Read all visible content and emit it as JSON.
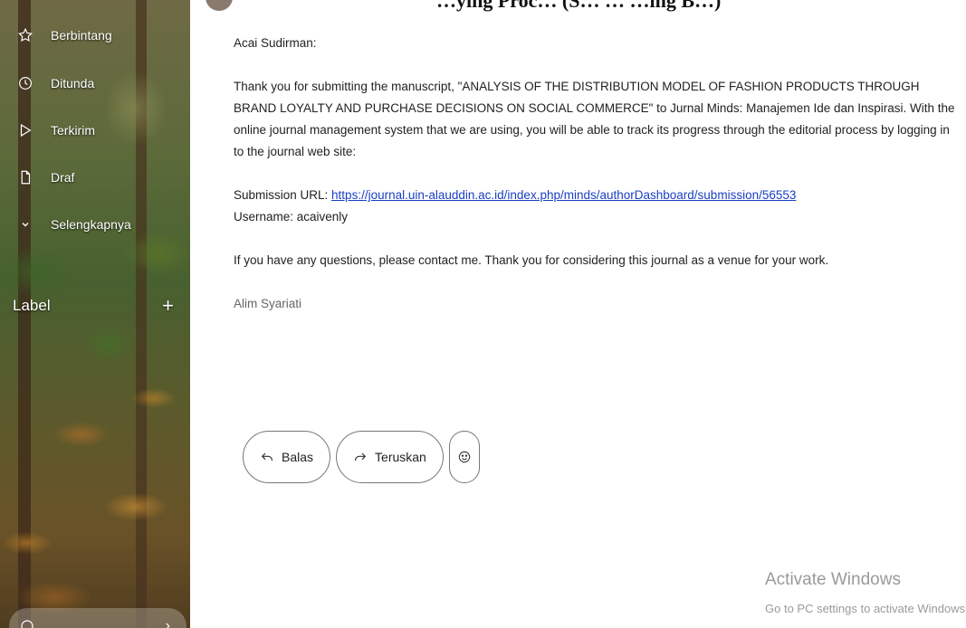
{
  "sidebar": {
    "items": [
      {
        "label": "Berbintang",
        "icon": "star-icon"
      },
      {
        "label": "Ditunda",
        "icon": "clock-icon"
      },
      {
        "label": "Terkirim",
        "icon": "send-icon"
      },
      {
        "label": "Draf",
        "icon": "draft-file-icon"
      },
      {
        "label": "Selengkapnya",
        "icon": "chevron-down-icon"
      }
    ],
    "label_section": {
      "title": "Label",
      "add_symbol": "+"
    }
  },
  "email": {
    "top_fragment": "…ying Proc… (S… … …ing B…)",
    "greeting": "Acai Sudirman:",
    "body": "Thank you for submitting the manuscript, \"ANALYSIS OF THE DISTRIBUTION MODEL OF FASHION PRODUCTS THROUGH BRAND LOYALTY AND PURCHASE DECISIONS ON SOCIAL COMMERCE\" to Jurnal Minds: Manajemen Ide dan Inspirasi. With the online journal management system that we are using, you will be able to track its progress through the editorial process by logging in to the journal web site:",
    "submission_label": "Submission URL: ",
    "submission_url": "https://journal.uin-alauddin.ac.id/index.php/minds/authorDashboard/submission/56553",
    "username_line": "Username: acaivenly",
    "closing": "If you have any questions, please contact me. Thank you for considering this journal as a venue for your work.",
    "signature": "Alim Syariati"
  },
  "actions": {
    "reply_label": "Balas",
    "forward_label": "Teruskan"
  },
  "watermark": {
    "line1": "Activate Windows",
    "line2": "Go to PC settings to activate Windows."
  }
}
